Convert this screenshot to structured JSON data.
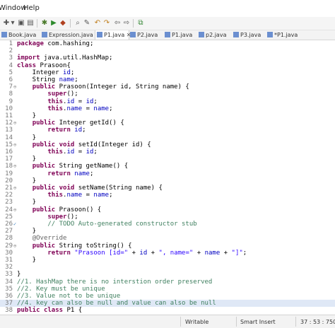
{
  "menubar": {
    "items": [
      "Window",
      "Help"
    ]
  },
  "toolbar": {
    "icons": [
      "new-icon",
      "dropdown-icon",
      "save-icon",
      "print-icon",
      "debug-icon",
      "run-icon",
      "external-tools-icon",
      "search-icon",
      "annotation-icon",
      "prev-annotation-icon",
      "next-annotation-icon",
      "back-icon",
      "forward-icon",
      "pin-icon"
    ]
  },
  "tabs": [
    {
      "label": "Book.java",
      "active": false
    },
    {
      "label": "Expression.java",
      "active": false
    },
    {
      "label": "P1.java",
      "active": true,
      "close": "✕"
    },
    {
      "label": "P2.java",
      "active": false
    },
    {
      "label": "P1.java",
      "active": false
    },
    {
      "label": "p2.java",
      "active": false
    },
    {
      "label": "P3.java",
      "active": false
    },
    {
      "label": "*P1.java",
      "active": false
    }
  ],
  "editor": {
    "lines": [
      {
        "n": "1",
        "t": "package com.hashing;"
      },
      {
        "n": "2",
        "t": ""
      },
      {
        "n": "3",
        "t": "import java.util.HashMap;"
      },
      {
        "n": "4",
        "t": "class Prasoon{"
      },
      {
        "n": "5",
        "t": "    Integer id;"
      },
      {
        "n": "6",
        "t": "    String name;"
      },
      {
        "n": "7",
        "t": "    public Prasoon(Integer id, String name) {",
        "fold": "⊖"
      },
      {
        "n": "8",
        "t": "        super();"
      },
      {
        "n": "9",
        "t": "        this.id = id;"
      },
      {
        "n": "10",
        "t": "        this.name = name;"
      },
      {
        "n": "11",
        "t": "    }"
      },
      {
        "n": "12",
        "t": "    public Integer getId() {",
        "fold": "⊖"
      },
      {
        "n": "13",
        "t": "        return id;"
      },
      {
        "n": "14",
        "t": "    }"
      },
      {
        "n": "15",
        "t": "    public void setId(Integer id) {",
        "fold": "⊖"
      },
      {
        "n": "16",
        "t": "        this.id = id;"
      },
      {
        "n": "17",
        "t": "    }"
      },
      {
        "n": "18",
        "t": "    public String getName() {",
        "fold": "⊖"
      },
      {
        "n": "19",
        "t": "        return name;"
      },
      {
        "n": "20",
        "t": "    }"
      },
      {
        "n": "21",
        "t": "    public void setName(String name) {",
        "fold": "⊖"
      },
      {
        "n": "22",
        "t": "        this.name = name;"
      },
      {
        "n": "23",
        "t": "    }"
      },
      {
        "n": "24",
        "t": "    public Prasoon() {",
        "fold": "⊖"
      },
      {
        "n": "25",
        "t": "        super();"
      },
      {
        "n": "26",
        "t": "        // TODO Auto-generated constructor stub",
        "fold": "✓"
      },
      {
        "n": "27",
        "t": "    }"
      },
      {
        "n": "28",
        "t": "    @Override"
      },
      {
        "n": "29",
        "t": "    public String toString() {",
        "fold": "⊖"
      },
      {
        "n": "30",
        "t": "        return \"Prasoon [id=\" + id + \", name=\" + name + \"]\";"
      },
      {
        "n": "31",
        "t": "    }"
      },
      {
        "n": "32",
        "t": ""
      },
      {
        "n": "33",
        "t": "}"
      },
      {
        "n": "34",
        "t": "//1. HashMap there is no interstion order preserved"
      },
      {
        "n": "35",
        "t": "//2. Key must be unique"
      },
      {
        "n": "36",
        "t": "//3. Value not to be unique"
      },
      {
        "n": "37",
        "t": "//4. key can also be null and value can also be null"
      },
      {
        "n": "38",
        "t": "public class P1 {"
      }
    ],
    "highlight_line": "37"
  },
  "status": {
    "mode": "Writable",
    "insert": "Smart Insert",
    "position": "37 : 53 : 750"
  },
  "colors": {
    "keyword": "#7f0055",
    "field": "#0000c0",
    "string": "#2a00ff",
    "comment": "#3f7f5f",
    "annotation": "#646464",
    "current_line": "#dfe8f6"
  }
}
